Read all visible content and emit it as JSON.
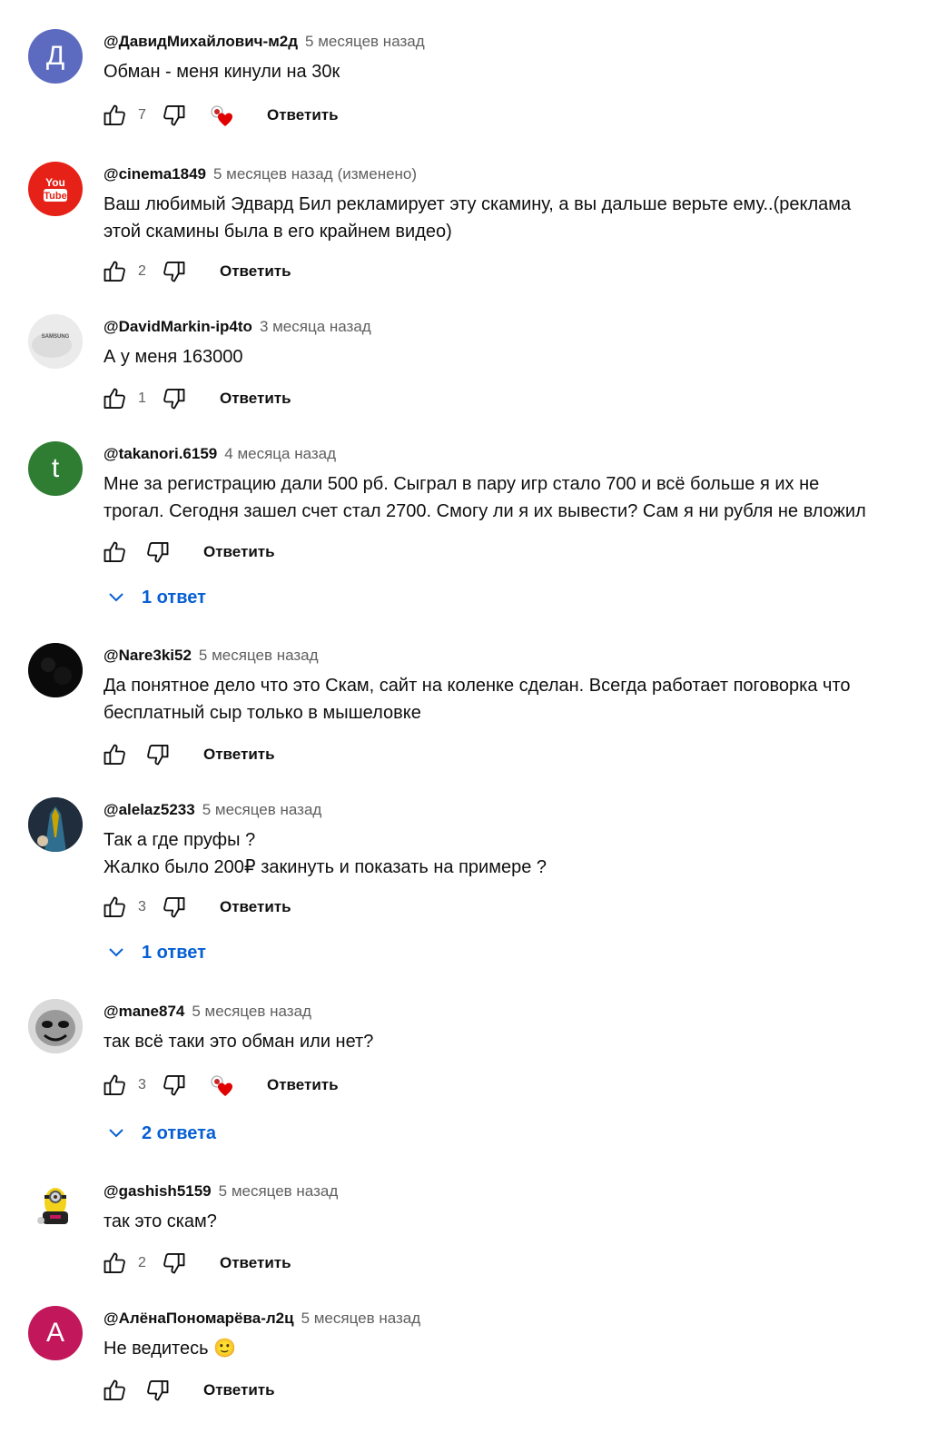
{
  "reply_label": "Ответить",
  "comments": [
    {
      "author": "@ДавидМихайлович-м2д",
      "time": "5 месяцев назад",
      "text": "Обман - меня кинули на 30к",
      "likes": "7",
      "avatar_letter": "Д",
      "avatar_color": "#5c6bc0"
    },
    {
      "author": "@cinema1849",
      "time": "5 месяцев назад",
      "edited": "(изменено)",
      "text": "Ваш любимый Эдвард Бил рекламирует эту скамину, а вы дальше верьте ему..(реклама\nэтой скамины была в его крайнем видео)",
      "likes": "2",
      "avatar_text": "You Tube"
    },
    {
      "author": "@DavidMarkin-ip4to",
      "time": "3 месяца назад",
      "text": "А у меня 163000",
      "likes": "1",
      "avatar_text": "SAMSUNG"
    },
    {
      "author": "@takanori.6159",
      "time": "4 месяца назад",
      "text": "Мне за регистрацию дали 500 рб. Сыграл в пару игр стало 700 и всё больше я их не\nтрогал. Сегодня зашел счет стал 2700. Смогу ли я их вывести? Сам я ни рубля не вложил",
      "likes": "",
      "avatar_letter": "t",
      "avatar_color": "#2e7d32",
      "replies": "1 ответ"
    },
    {
      "author": "@Nare3ki52",
      "time": "5 месяцев назад",
      "text": "Да понятное дело что это Скам, сайт на коленке сделан. Всегда работает поговорка что\nбесплатный сыр только в мышеловке",
      "likes": ""
    },
    {
      "author": "@alelaz5233",
      "time": "5 месяцев назад",
      "text": "Так а где пруфы ?\nЖалко было 200₽ закинуть и показать на примере ?",
      "likes": "3",
      "replies": "1 ответ"
    },
    {
      "author": "@mane874",
      "time": "5 месяцев назад",
      "text": "так всё таки это обман или нет?",
      "likes": "3",
      "replies": "2 ответа"
    },
    {
      "author": "@gashish5159",
      "time": "5 месяцев назад",
      "text": "так это скам?",
      "likes": "2"
    },
    {
      "author": "@АлёнаПономарёва-л2ц",
      "time": "5 месяцев назад",
      "text": "Не ведитесь 🙂",
      "likes": "",
      "avatar_letter": "А",
      "avatar_color": "#c2185b"
    }
  ]
}
